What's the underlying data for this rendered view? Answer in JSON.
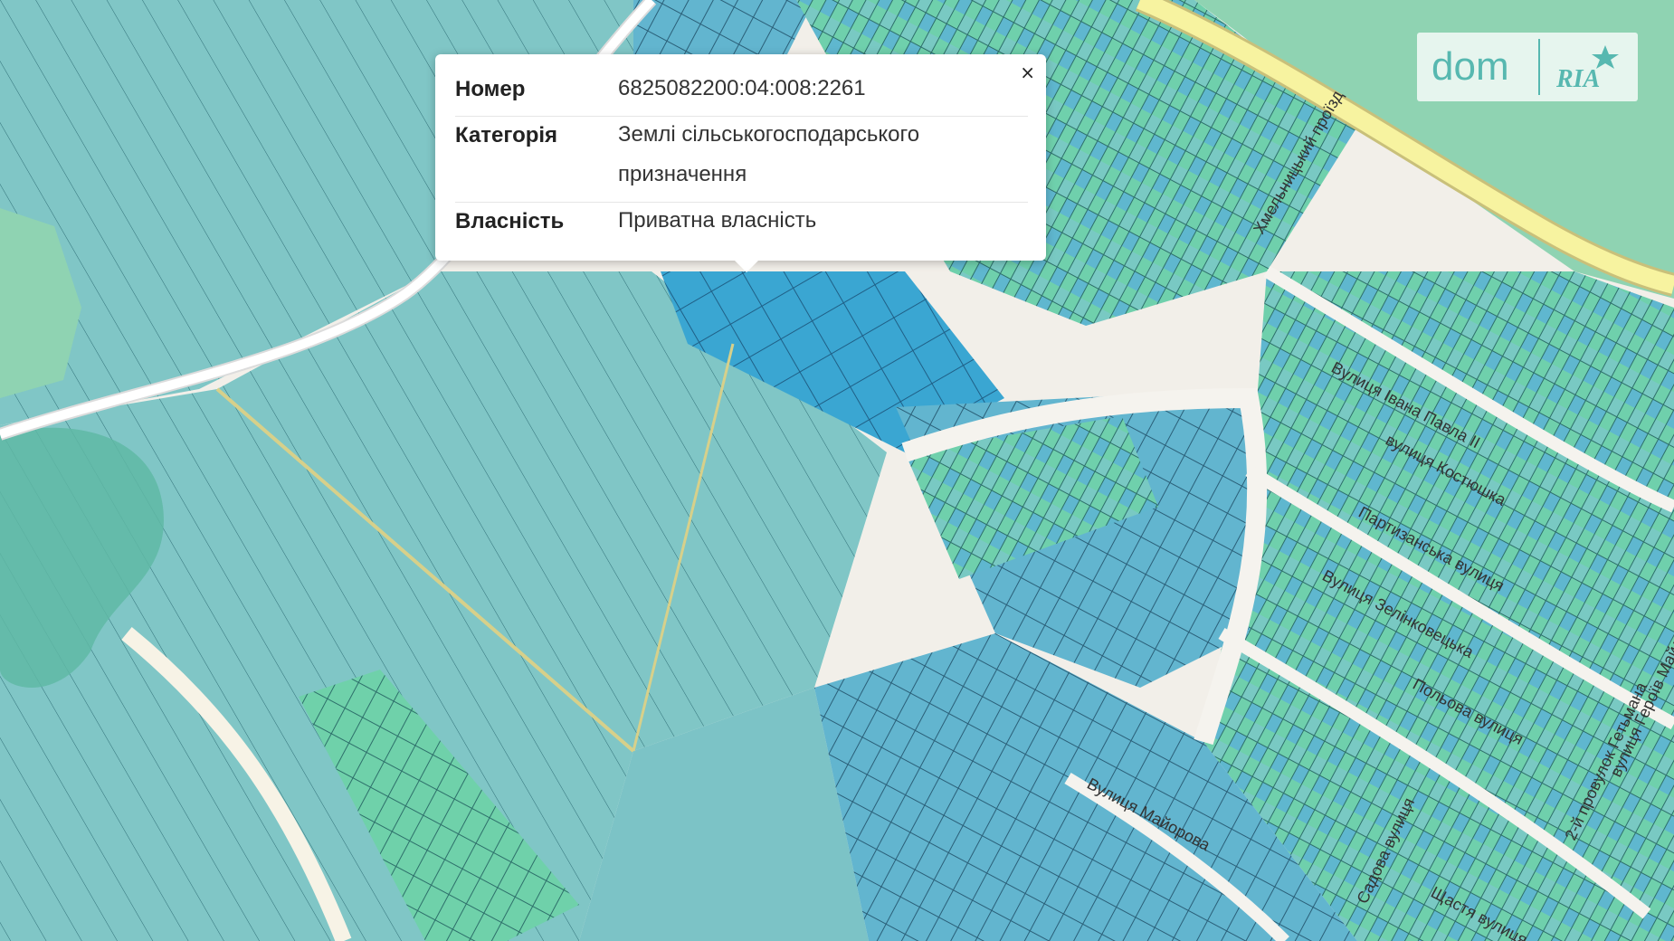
{
  "popup": {
    "close_label": "×",
    "rows": [
      {
        "key": "Номер",
        "value": "6825082200:04:008:2261"
      },
      {
        "key": "Категорія",
        "value": "Землі сільськогосподарського призначення"
      },
      {
        "key": "Власність",
        "value": "Приватна власність"
      }
    ]
  },
  "logo": {
    "dom": "dom",
    "ria": "RIA"
  },
  "streets": [
    "Вулиця Івана Павла ІІ",
    "вулиця Костюшка",
    "Партизанська вулиця",
    "Вулиця Зелінковецька",
    "Польова вулиця",
    "вулиця Героїв Майдану",
    "2-й провулок Гетьмана",
    "Вулиця Майорова",
    "Садова вулиця",
    "Щастя вулиця",
    "Хмельницький проїзд"
  ],
  "colors": {
    "background": "#f2efe9",
    "parcel_teal": "#7ec4c4",
    "parcel_green": "#6dd0a8",
    "parcel_blue": "#5bb0d6",
    "selected": "#2f9fd0",
    "road": "#ffffff",
    "main_road": "#f7f3a0",
    "forest": "#8fd3b2"
  }
}
